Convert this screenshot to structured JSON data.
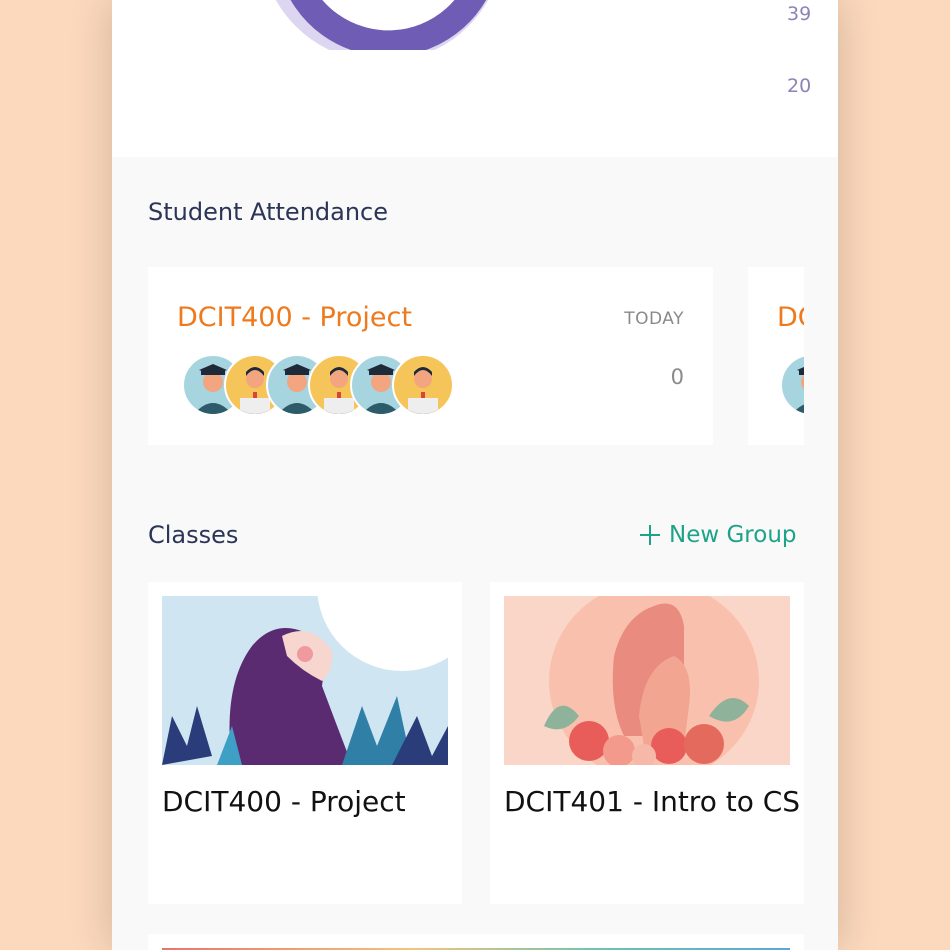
{
  "chart": {
    "axis_labels": [
      "39",
      "20"
    ],
    "colors": {
      "ring": "#6f5cb4",
      "ring_light": "#dcd6f0"
    }
  },
  "attendance": {
    "title": "Student Attendance",
    "cards": [
      {
        "course": "DCIT400 - Project",
        "period": "TODAY",
        "count": "0"
      },
      {
        "course": "DC"
      }
    ]
  },
  "classes": {
    "title": "Classes",
    "new_group_label": "New Group",
    "items": [
      {
        "name": "DCIT400 - Project"
      },
      {
        "name": "DCIT401 - Intro to CS"
      }
    ]
  },
  "colors": {
    "accent_orange": "#ee7a1d",
    "accent_green": "#1ea38a",
    "heading": "#2b3557"
  }
}
